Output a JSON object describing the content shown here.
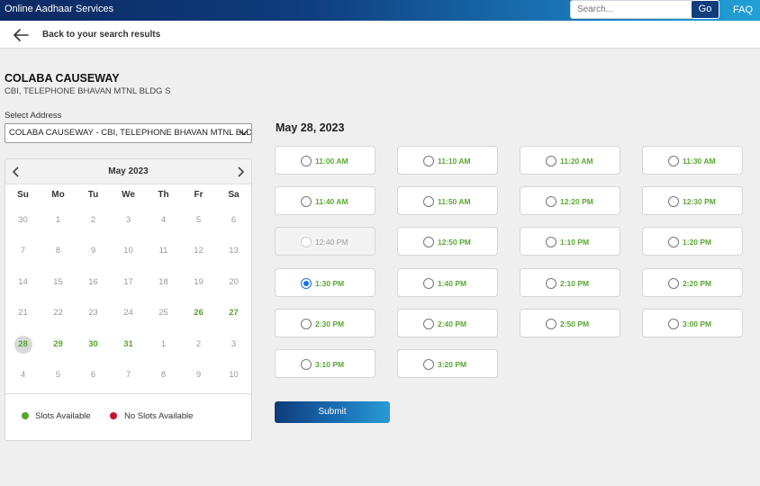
{
  "header": {
    "app_title": "Online Aadhaar Services",
    "search_placeholder": "Search...",
    "go_label": "Go",
    "faq_label": "FAQ"
  },
  "backbar": {
    "label": "Back to your search results"
  },
  "center": {
    "name": "COLABA CAUSEWAY",
    "address": "CBI, TELEPHONE BHAVAN MTNL BLDG S"
  },
  "address_select": {
    "label": "Select Address",
    "value": "COLABA CAUSEWAY - CBI, TELEPHONE BHAVAN MTNL BLDG S"
  },
  "calendar": {
    "month": "May 2023",
    "weekdays": [
      "Su",
      "Mo",
      "Tu",
      "We",
      "Th",
      "Fr",
      "Sa"
    ],
    "weeks": [
      [
        {
          "d": "30",
          "s": "off"
        },
        {
          "d": "1",
          "s": "off"
        },
        {
          "d": "2",
          "s": "off"
        },
        {
          "d": "3",
          "s": "off"
        },
        {
          "d": "4",
          "s": "off"
        },
        {
          "d": "5",
          "s": "off"
        },
        {
          "d": "6",
          "s": "off"
        }
      ],
      [
        {
          "d": "7",
          "s": "off"
        },
        {
          "d": "8",
          "s": "off"
        },
        {
          "d": "9",
          "s": "off"
        },
        {
          "d": "10",
          "s": "off"
        },
        {
          "d": "11",
          "s": "off"
        },
        {
          "d": "12",
          "s": "off"
        },
        {
          "d": "13",
          "s": "off"
        }
      ],
      [
        {
          "d": "14",
          "s": "off"
        },
        {
          "d": "15",
          "s": "off"
        },
        {
          "d": "16",
          "s": "off"
        },
        {
          "d": "17",
          "s": "off"
        },
        {
          "d": "18",
          "s": "off"
        },
        {
          "d": "19",
          "s": "off"
        },
        {
          "d": "20",
          "s": "off"
        }
      ],
      [
        {
          "d": "21",
          "s": "off"
        },
        {
          "d": "22",
          "s": "off"
        },
        {
          "d": "23",
          "s": "off"
        },
        {
          "d": "24",
          "s": "off"
        },
        {
          "d": "25",
          "s": "off"
        },
        {
          "d": "26",
          "s": "avail"
        },
        {
          "d": "27",
          "s": "avail"
        }
      ],
      [
        {
          "d": "28",
          "s": "selected"
        },
        {
          "d": "29",
          "s": "avail"
        },
        {
          "d": "30",
          "s": "avail"
        },
        {
          "d": "31",
          "s": "avail"
        },
        {
          "d": "1",
          "s": "off"
        },
        {
          "d": "2",
          "s": "off"
        },
        {
          "d": "3",
          "s": "off"
        }
      ],
      [
        {
          "d": "4",
          "s": "off"
        },
        {
          "d": "5",
          "s": "off"
        },
        {
          "d": "6",
          "s": "off"
        },
        {
          "d": "7",
          "s": "off"
        },
        {
          "d": "8",
          "s": "off"
        },
        {
          "d": "9",
          "s": "off"
        },
        {
          "d": "10",
          "s": "off"
        }
      ]
    ],
    "legend": [
      {
        "label": "Slots Available",
        "color": "#55a42d"
      },
      {
        "label": "No Slots Available",
        "color": "#c8102e"
      }
    ]
  },
  "slots": {
    "date": "May 28, 2023",
    "items": [
      {
        "time": "11:00 AM",
        "state": "available"
      },
      {
        "time": "11:10 AM",
        "state": "available"
      },
      {
        "time": "11:20 AM",
        "state": "available"
      },
      {
        "time": "11:30 AM",
        "state": "available"
      },
      {
        "time": "11:40 AM",
        "state": "available"
      },
      {
        "time": "11:50 AM",
        "state": "available"
      },
      {
        "time": "12:20 PM",
        "state": "available"
      },
      {
        "time": "12:30 PM",
        "state": "available"
      },
      {
        "time": "12:40 PM",
        "state": "disabled"
      },
      {
        "time": "12:50 PM",
        "state": "available"
      },
      {
        "time": "1:10 PM",
        "state": "available"
      },
      {
        "time": "1:20 PM",
        "state": "available"
      },
      {
        "time": "1:30 PM",
        "state": "selected"
      },
      {
        "time": "1:40 PM",
        "state": "available"
      },
      {
        "time": "2:10 PM",
        "state": "available"
      },
      {
        "time": "2:20 PM",
        "state": "available"
      },
      {
        "time": "2:30 PM",
        "state": "available"
      },
      {
        "time": "2:40 PM",
        "state": "available"
      },
      {
        "time": "2:50 PM",
        "state": "available"
      },
      {
        "time": "3:00 PM",
        "state": "available"
      },
      {
        "time": "3:10 PM",
        "state": "available"
      },
      {
        "time": "3:20 PM",
        "state": "available"
      }
    ]
  },
  "submit_label": "Submit",
  "icons": {
    "back": "arrow-left-icon",
    "prev": "chevron-left-icon",
    "next": "chevron-right-icon",
    "dropdown": "chevron-down-icon"
  }
}
